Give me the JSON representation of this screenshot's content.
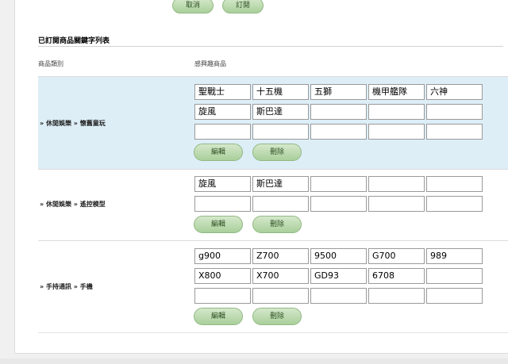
{
  "top_actions": {
    "cancel_label": "取消",
    "subscribe_label": "訂閱"
  },
  "section": {
    "title": "已訂閱商品關鍵字列表"
  },
  "columns": {
    "category": "商品類別",
    "interest": "感興趣商品"
  },
  "groups": [
    {
      "category": "» 休閒娛樂 » 懷舊童玩",
      "highlighted": true,
      "keywords": [
        [
          "聖戰士",
          "十五機",
          "五獅",
          "機甲艦隊",
          "六神"
        ],
        [
          "旋風",
          "斯巴達",
          "",
          "",
          ""
        ],
        [
          "",
          "",
          "",
          "",
          ""
        ]
      ],
      "edit_label": "編輯",
      "delete_label": "刪除"
    },
    {
      "category": "» 休閒娛樂 » 遙控模型",
      "highlighted": false,
      "keywords": [
        [
          "旋風",
          "斯巴達",
          "",
          "",
          ""
        ],
        [
          "",
          "",
          "",
          "",
          ""
        ]
      ],
      "edit_label": "編輯",
      "delete_label": "刪除"
    },
    {
      "category": "» 手持通訊 » 手機",
      "highlighted": false,
      "keywords": [
        [
          "g900",
          "Z700",
          "9500",
          "G700",
          "989"
        ],
        [
          "X800",
          "X700",
          "GD93",
          "6708",
          ""
        ],
        [
          "",
          "",
          "",
          "",
          ""
        ]
      ],
      "edit_label": "編輯",
      "delete_label": "刪除"
    }
  ]
}
